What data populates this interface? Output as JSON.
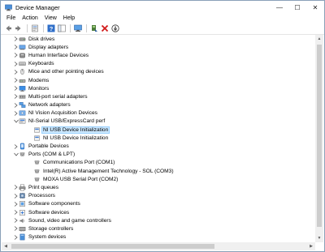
{
  "window": {
    "title": "Device Manager",
    "minimize": "—",
    "maximize": "☐",
    "close": "✕"
  },
  "menu": [
    "File",
    "Action",
    "View",
    "Help"
  ],
  "toolbar": [
    "back-icon",
    "forward-icon",
    "sep",
    "properties-icon",
    "sep",
    "help-icon",
    "console-tree-icon",
    "sep",
    "scan-hardware-icon",
    "sep",
    "update-driver-icon",
    "uninstall-icon",
    "disable-icon"
  ],
  "tree": [
    {
      "label": "Disk drives",
      "level": 0,
      "expander": ">",
      "icon": "disk-drive-icon"
    },
    {
      "label": "Display adapters",
      "level": 0,
      "expander": ">",
      "icon": "display-adapter-icon"
    },
    {
      "label": "Human Interface Devices",
      "level": 0,
      "expander": ">",
      "icon": "hid-icon"
    },
    {
      "label": "Keyboards",
      "level": 0,
      "expander": ">",
      "icon": "keyboard-icon"
    },
    {
      "label": "Mice and other pointing devices",
      "level": 0,
      "expander": ">",
      "icon": "mouse-icon"
    },
    {
      "label": "Modems",
      "level": 0,
      "expander": ">",
      "icon": "modem-icon"
    },
    {
      "label": "Monitors",
      "level": 0,
      "expander": ">",
      "icon": "monitor-icon"
    },
    {
      "label": "Multi-port serial adapters",
      "level": 0,
      "expander": ">",
      "icon": "serial-adapter-icon"
    },
    {
      "label": "Network adapters",
      "level": 0,
      "expander": ">",
      "icon": "network-adapter-icon"
    },
    {
      "label": "NI Vision Acquisition Devices",
      "level": 0,
      "expander": ">",
      "icon": "ni-vision-icon"
    },
    {
      "label": "NI-Serial USB/ExpressCard perf",
      "level": 0,
      "expander": "v",
      "icon": "ni-serial-icon"
    },
    {
      "label": "NI USB Device Initialization",
      "level": 1,
      "expander": "",
      "icon": "ni-device-icon",
      "selected": true
    },
    {
      "label": "NI USB Device Initialization",
      "level": 1,
      "expander": "",
      "icon": "ni-device-icon"
    },
    {
      "label": "Portable Devices",
      "level": 0,
      "expander": ">",
      "icon": "portable-device-icon"
    },
    {
      "label": "Ports (COM & LPT)",
      "level": 0,
      "expander": "v",
      "icon": "port-icon"
    },
    {
      "label": "Communications Port (COM1)",
      "level": 1,
      "expander": "",
      "icon": "port-icon"
    },
    {
      "label": "Intel(R) Active Management Technology - SOL (COM3)",
      "level": 1,
      "expander": "",
      "icon": "port-icon"
    },
    {
      "label": "MOXA USB Serial Port (COM2)",
      "level": 1,
      "expander": "",
      "icon": "port-icon"
    },
    {
      "label": "Print queues",
      "level": 0,
      "expander": ">",
      "icon": "printer-icon"
    },
    {
      "label": "Processors",
      "level": 0,
      "expander": ">",
      "icon": "processor-icon"
    },
    {
      "label": "Software components",
      "level": 0,
      "expander": ">",
      "icon": "software-component-icon"
    },
    {
      "label": "Software devices",
      "level": 0,
      "expander": ">",
      "icon": "software-device-icon"
    },
    {
      "label": "Sound, video and game controllers",
      "level": 0,
      "expander": ">",
      "icon": "sound-icon"
    },
    {
      "label": "Storage controllers",
      "level": 0,
      "expander": ">",
      "icon": "storage-controller-icon"
    },
    {
      "label": "System devices",
      "level": 0,
      "expander": ">",
      "icon": "system-device-icon"
    }
  ],
  "colors": {
    "selection": "#cce8ff",
    "selection_border": "#99d1ff",
    "icon_blue": "#3a7bd5",
    "icon_gray": "#7a7a7a",
    "uninstall_red": "#d11a1a"
  }
}
